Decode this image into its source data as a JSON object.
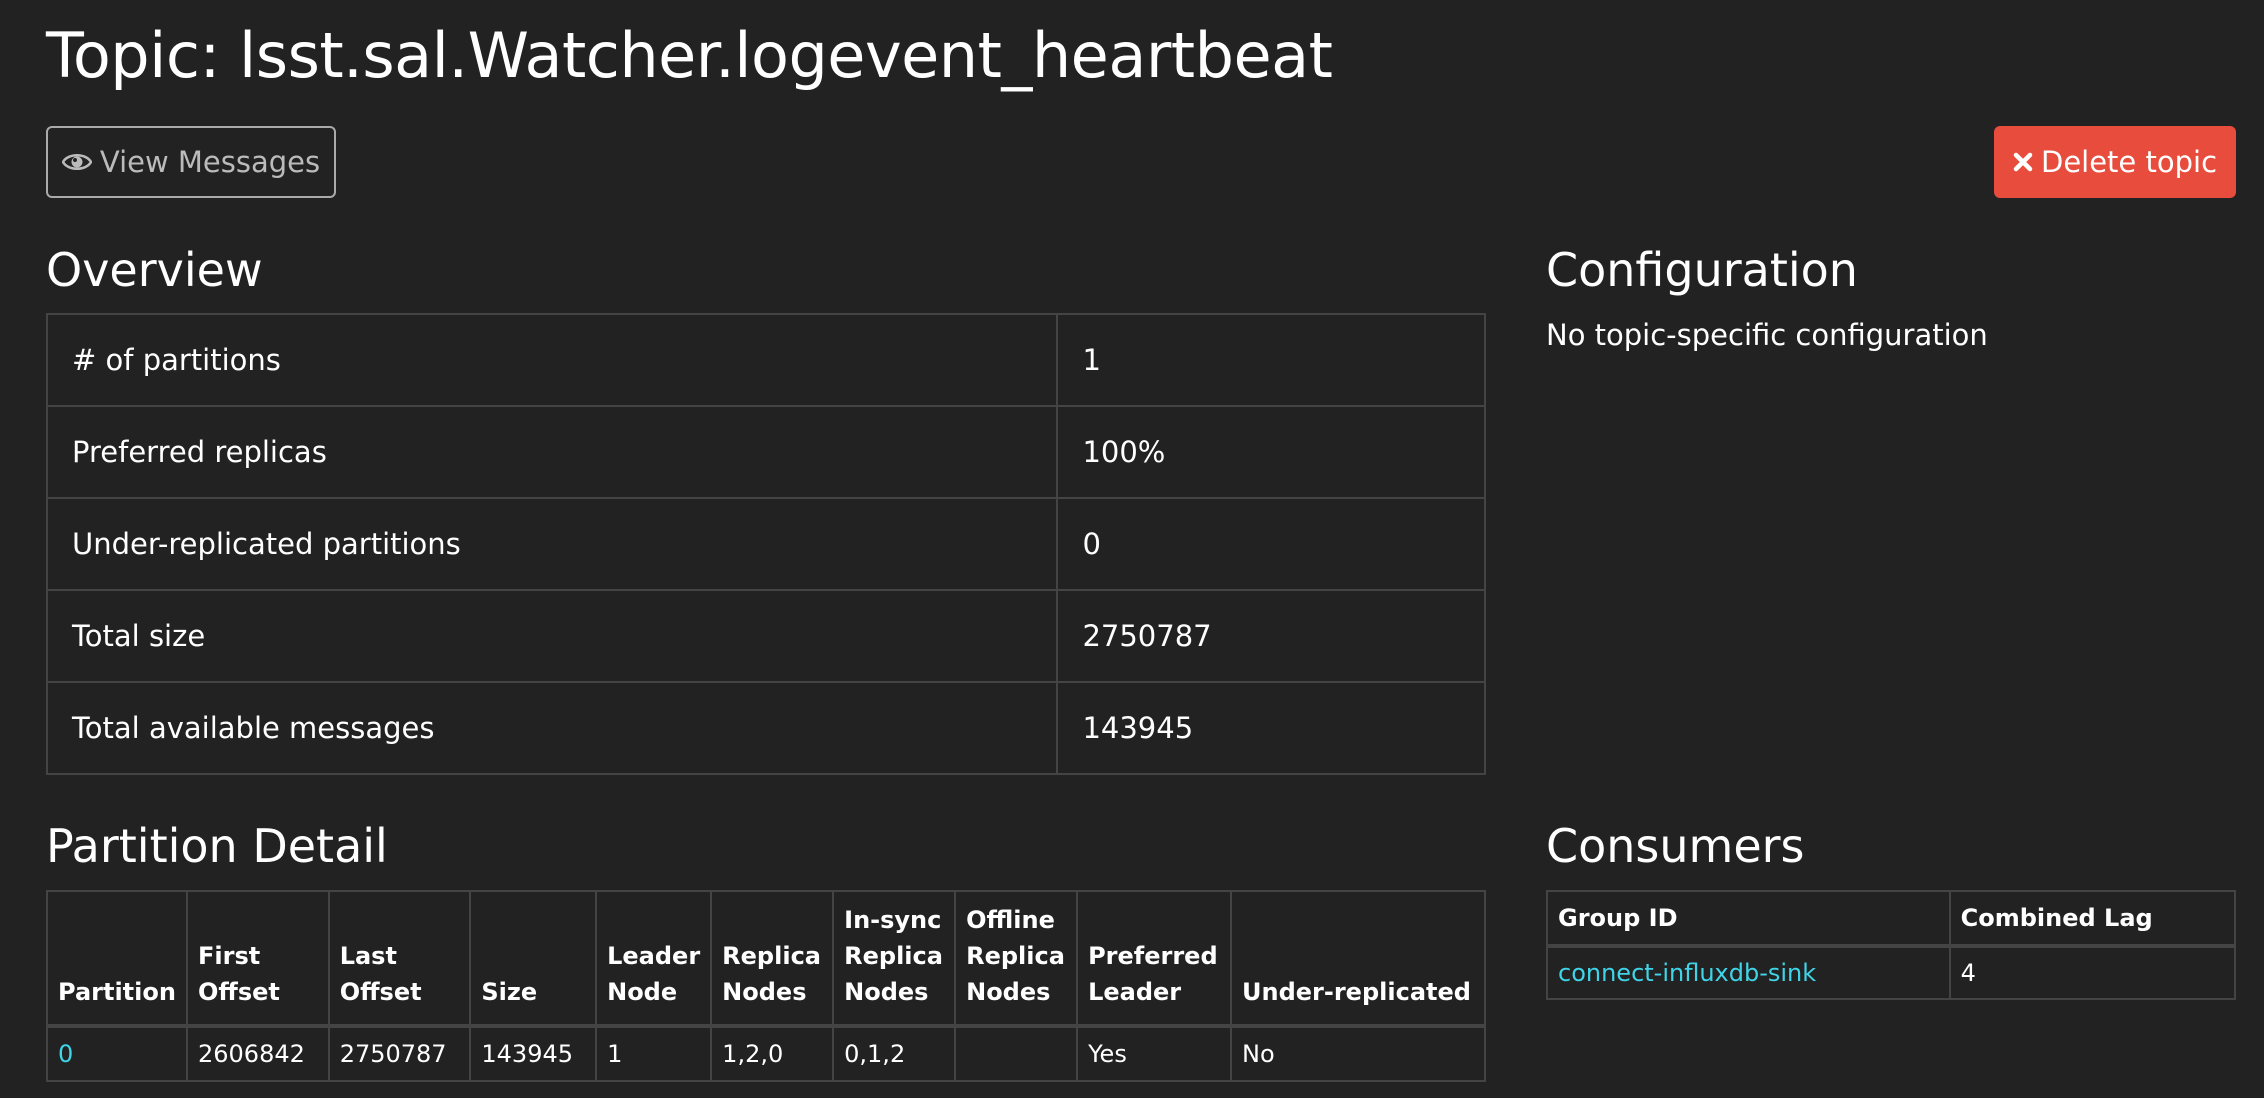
{
  "page": {
    "title": "Topic: lsst.sal.Watcher.logevent_heartbeat"
  },
  "actions": {
    "view_messages": "View Messages",
    "delete_topic": "Delete topic"
  },
  "overview": {
    "heading": "Overview",
    "rows": [
      {
        "label": "# of partitions",
        "value": "1"
      },
      {
        "label": "Preferred replicas",
        "value": "100%"
      },
      {
        "label": "Under-replicated partitions",
        "value": "0"
      },
      {
        "label": "Total size",
        "value": "2750787"
      },
      {
        "label": "Total available messages",
        "value": "143945"
      }
    ]
  },
  "configuration": {
    "heading": "Configuration",
    "text": "No topic-specific configuration"
  },
  "partition_detail": {
    "heading": "Partition Detail",
    "columns": [
      {
        "l1": "",
        "l2": "",
        "l3": "Partition"
      },
      {
        "l1": "",
        "l2": "First",
        "l3": "Offset"
      },
      {
        "l1": "",
        "l2": "Last",
        "l3": "Offset"
      },
      {
        "l1": "",
        "l2": "",
        "l3": "Size"
      },
      {
        "l1": "",
        "l2": "Leader",
        "l3": "Node"
      },
      {
        "l1": "",
        "l2": "Replica",
        "l3": "Nodes"
      },
      {
        "l1": "In-sync",
        "l2": "Replica",
        "l3": "Nodes"
      },
      {
        "l1": "Offline",
        "l2": "Replica",
        "l3": "Nodes"
      },
      {
        "l1": "",
        "l2": "Preferred",
        "l3": "Leader"
      },
      {
        "l1": "",
        "l2": "",
        "l3": "Under-replicated"
      }
    ],
    "rows": [
      [
        "0",
        "2606842",
        "2750787",
        "143945",
        "1",
        "1,2,0",
        "0,1,2",
        "",
        "Yes",
        "No"
      ]
    ]
  },
  "consumers": {
    "heading": "Consumers",
    "columns": [
      "Group ID",
      "Combined Lag"
    ],
    "rows": [
      [
        "connect-influxdb-sink",
        "4"
      ]
    ]
  },
  "colors": {
    "background": "#222222",
    "link": "#3fd4e8",
    "danger": "#e74c3c",
    "border": "#444444"
  }
}
